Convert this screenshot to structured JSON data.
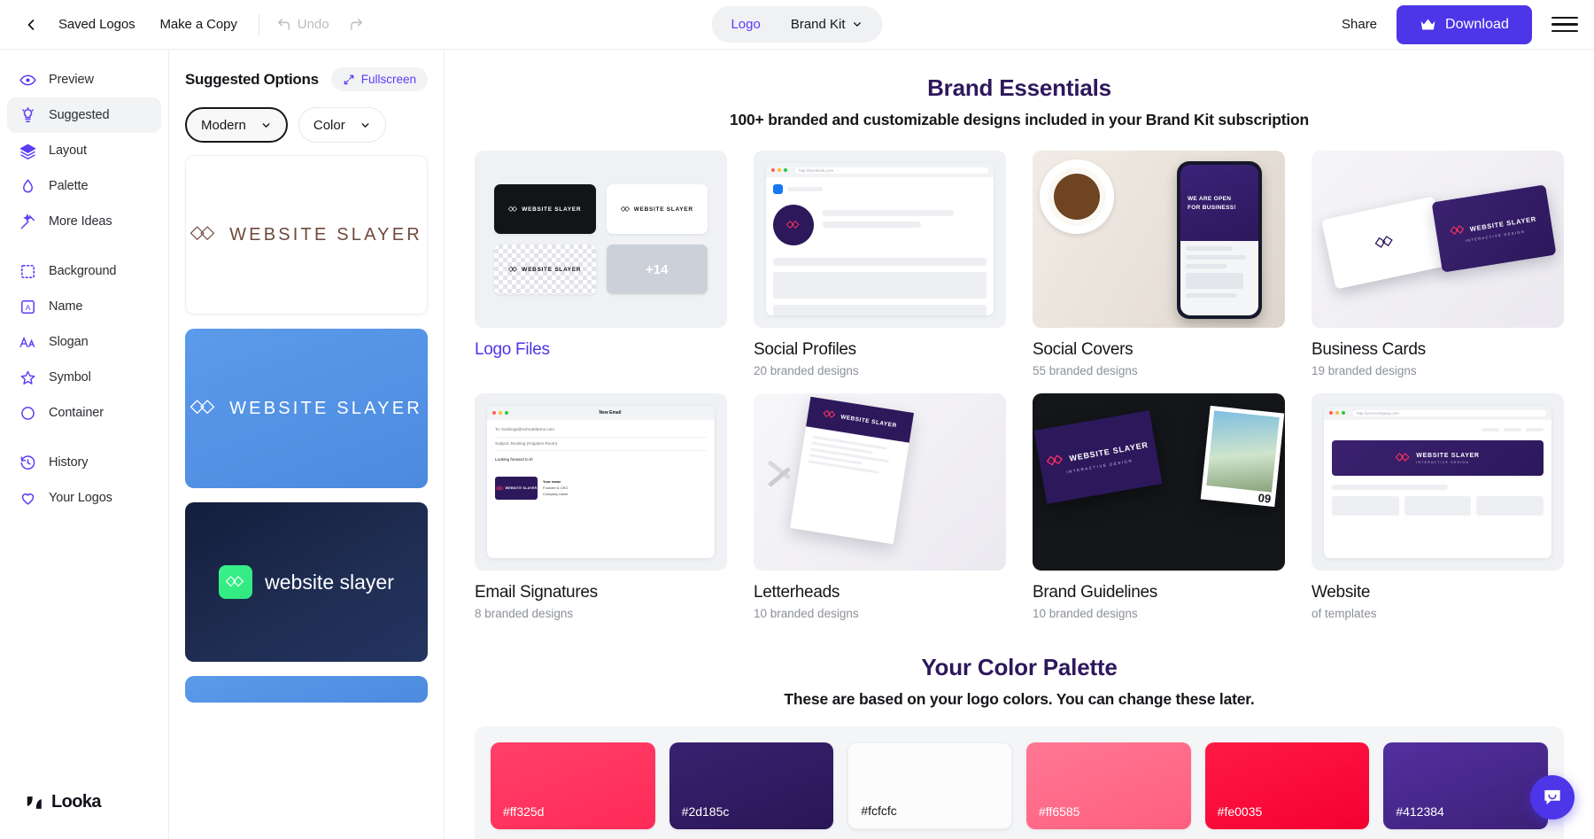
{
  "topbar": {
    "back_icon": "chevron-left-icon",
    "saved_logos": "Saved Logos",
    "make_a_copy": "Make a Copy",
    "undo": "Undo",
    "redo_icon": "redo-icon",
    "tab_logo": "Logo",
    "tab_brand_kit": "Brand Kit",
    "share": "Share",
    "download": "Download",
    "download_icon": "crown-icon",
    "menu_icon": "hamburger-menu-icon"
  },
  "sidebar": {
    "items": [
      {
        "label": "Preview",
        "icon": "eye-icon",
        "active": false
      },
      {
        "label": "Suggested",
        "icon": "lightbulb-icon",
        "active": true
      },
      {
        "label": "Layout",
        "icon": "layers-icon",
        "active": false
      },
      {
        "label": "Palette",
        "icon": "droplet-icon",
        "active": false
      },
      {
        "label": "More Ideas",
        "icon": "magic-wand-icon",
        "active": false
      },
      {
        "label": "Background",
        "icon": "dotted-square-icon",
        "active": false
      },
      {
        "label": "Name",
        "icon": "letter-a-box-icon",
        "active": false
      },
      {
        "label": "Slogan",
        "icon": "font-size-icon",
        "active": false
      },
      {
        "label": "Symbol",
        "icon": "star-icon",
        "active": false
      },
      {
        "label": "Container",
        "icon": "circle-icon",
        "active": false
      },
      {
        "label": "History",
        "icon": "clock-history-icon",
        "active": false
      },
      {
        "label": "Your Logos",
        "icon": "heart-icon",
        "active": false
      }
    ],
    "brand": "Looka",
    "brand_icon": "looka-logo-icon"
  },
  "options_panel": {
    "title": "Suggested Options",
    "fullscreen": "Fullscreen",
    "fullscreen_icon": "expand-arrows-icon",
    "filters": [
      {
        "label": "Modern",
        "selected": true
      },
      {
        "label": "Color",
        "selected": false
      }
    ],
    "logo_cards": [
      {
        "style": "white",
        "text": "WEBSITE SLAYER"
      },
      {
        "style": "blue",
        "text": "WEBSITE SLAYER"
      },
      {
        "style": "navy",
        "text": "website slayer"
      }
    ]
  },
  "main": {
    "section_title": "Brand Essentials",
    "section_subtitle": "100+ branded and customizable designs included in your Brand Kit subscription",
    "tiles": [
      {
        "name": "Logo Files",
        "sub": "",
        "is_link": true,
        "art": "logo-files"
      },
      {
        "name": "Social Profiles",
        "sub": "20 branded designs",
        "is_link": false,
        "art": "social-profiles"
      },
      {
        "name": "Social Covers",
        "sub": "55 branded designs",
        "is_link": false,
        "art": "social-covers"
      },
      {
        "name": "Business Cards",
        "sub": "19 branded designs",
        "is_link": false,
        "art": "business-cards"
      },
      {
        "name": "Email Signatures",
        "sub": "8 branded designs",
        "is_link": false,
        "art": "email-signatures"
      },
      {
        "name": "Letterheads",
        "sub": "10 branded designs",
        "is_link": false,
        "art": "letterheads"
      },
      {
        "name": "Brand Guidelines",
        "sub": "10 branded designs",
        "is_link": false,
        "art": "brand-guidelines"
      },
      {
        "name": "Website",
        "sub": "of templates",
        "is_link": false,
        "art": "website"
      }
    ],
    "palette_title": "Your Color Palette",
    "palette_subtitle": "These are based on your logo colors. You can change these later.",
    "swatches": [
      {
        "hex": "#ff325d",
        "label": "#ff325d",
        "text_color": "#ffffff"
      },
      {
        "hex": "#2d185c",
        "label": "#2d185c",
        "text_color": "#ffffff"
      },
      {
        "hex": "#fcfcfc",
        "label": "#fcfcfc",
        "text_color": "#15171a"
      },
      {
        "hex": "#ff6585",
        "label": "#ff6585",
        "text_color": "#ffffff"
      },
      {
        "hex": "#fe0035",
        "label": "#fe0035",
        "text_color": "#ffffff"
      },
      {
        "hex": "#412384",
        "label": "#412384",
        "text_color": "#ffffff"
      }
    ]
  },
  "chat": {
    "icon": "chat-bubble-icon"
  },
  "brand_colors": {
    "accent_purple": "#4d35e8",
    "link_purple": "#5b3df5",
    "heading_purple": "#2d185c",
    "logo_pink": "#ff325d"
  },
  "logo_text": {
    "main": "WEBSITE SLAYER",
    "sub": "INTERACTIVE DESIGN"
  }
}
